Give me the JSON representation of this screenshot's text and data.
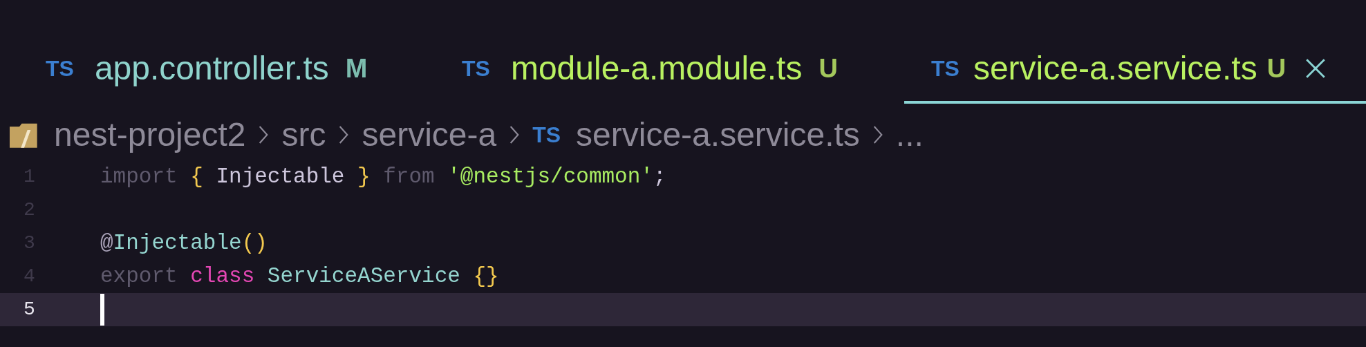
{
  "tabs": [
    {
      "icon_text": "TS",
      "label": "app.controller.ts",
      "badge": "M",
      "kind": "modified",
      "selected": false
    },
    {
      "icon_text": "TS",
      "label": "module-a.module.ts",
      "badge": "U",
      "kind": "untracked",
      "selected": false
    },
    {
      "icon_text": "TS",
      "label": "service-a.service.ts",
      "badge": "U",
      "kind": "untracked",
      "selected": true
    }
  ],
  "breadcrumb": [
    {
      "kind": "folder",
      "text": "nest-project2"
    },
    {
      "kind": "text",
      "text": "src"
    },
    {
      "kind": "text",
      "text": "service-a"
    },
    {
      "kind": "file",
      "icon_text": "TS",
      "text": "service-a.service.ts"
    },
    {
      "kind": "text",
      "text": "..."
    }
  ],
  "lines": [
    {
      "number": "1",
      "active": false,
      "tokens": [
        {
          "kind": "keyword",
          "text": "import"
        },
        {
          "kind": "brace",
          "text": "{"
        },
        {
          "kind": "name",
          "text": "Injectable"
        },
        {
          "kind": "brace",
          "text": "}"
        },
        {
          "kind": "keyword",
          "text": "from"
        },
        {
          "kind": "string",
          "text": "'@nestjs/common'"
        },
        {
          "kind": "punct",
          "text": ";",
          "joined": true
        }
      ]
    },
    {
      "number": "2",
      "active": false
    },
    {
      "number": "3",
      "active": false,
      "tokens": [
        {
          "kind": "at",
          "text": "@"
        },
        {
          "kind": "type",
          "text": "Injectable",
          "joined": true
        },
        {
          "kind": "brace",
          "text": "()",
          "joined": true
        }
      ]
    },
    {
      "number": "4",
      "active": false,
      "tokens": [
        {
          "kind": "keyword",
          "text": "export"
        },
        {
          "kind": "storage",
          "text": "class"
        },
        {
          "kind": "type",
          "text": "ServiceAService"
        },
        {
          "kind": "brace",
          "text": "{}"
        }
      ]
    },
    {
      "number": "5",
      "active": true
    }
  ]
}
